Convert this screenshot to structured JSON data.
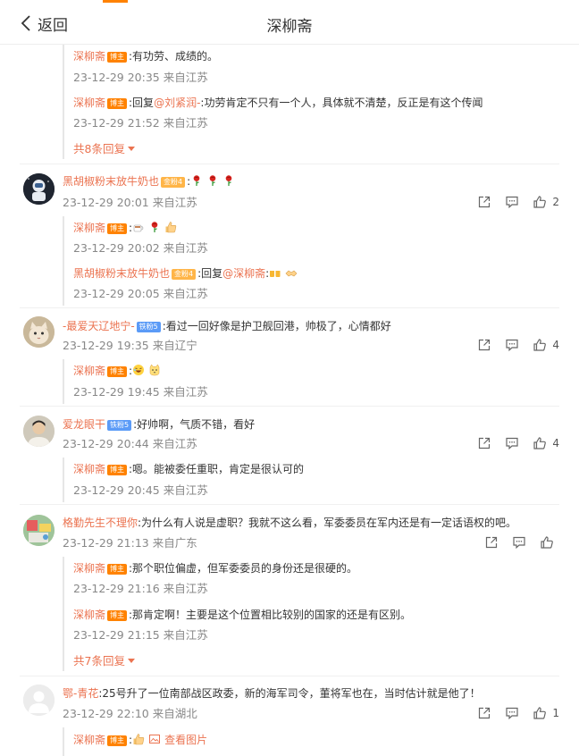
{
  "header": {
    "back_label": "返回",
    "title": "深柳斋"
  },
  "host_badge": "博主",
  "more_suffix": "回复",
  "comments": [
    {
      "replies": [
        {
          "name": "深柳斋",
          "badge": "博主",
          "text": ":有功劳、成绩的。",
          "time": "23-12-29 20:35 来自江苏"
        },
        {
          "name": "深柳斋",
          "badge": "博主",
          "pre": ":回复",
          "at": "@刘紧润-",
          "text": ":功劳肯定不只有一个人，具体就不清楚，反正是有这个传闻",
          "time": "23-12-29 21:52 来自江苏"
        }
      ],
      "more": "共8条回复"
    },
    {
      "name": "黑胡椒粉末放牛奶也",
      "badge": "金粉4",
      "text": ":",
      "emojis": [
        "rose",
        "rose",
        "rose"
      ],
      "time": "23-12-29 20:01 来自江苏",
      "likes": "2",
      "replies": [
        {
          "name": "深柳斋",
          "badge": "博主",
          "text": ":",
          "emojis": [
            "tea",
            "rose",
            "thumb"
          ],
          "time": "23-12-29 20:02 来自江苏"
        },
        {
          "name": "黑胡椒粉末放牛奶也",
          "badge": "金粉4",
          "pre": ":回复",
          "at": "@深柳斋",
          "text": ":",
          "emojis": [
            "beer",
            "hand"
          ],
          "time": "23-12-29 20:05 来自江苏"
        }
      ]
    },
    {
      "name": "-最爱天辽地宁-",
      "badge": "铁粉5",
      "text": ":看过一回好像是护卫舰回港，帅极了，心情都好",
      "time": "23-12-29 19:35 来自辽宁",
      "likes": "4",
      "replies": [
        {
          "name": "深柳斋",
          "badge": "博主",
          "text": ":",
          "emojis": [
            "laugh",
            "cat"
          ],
          "time": "23-12-29 19:45 来自江苏"
        }
      ]
    },
    {
      "name": "爱龙眼干",
      "badge": "铁粉5",
      "text": ":好帅啊，气质不错，看好",
      "time": "23-12-29 20:44 来自江苏",
      "likes": "4",
      "replies": [
        {
          "name": "深柳斋",
          "badge": "博主",
          "text": ":嗯。能被委任重职，肯定是很认可的",
          "time": "23-12-29 20:45 来自江苏"
        }
      ]
    },
    {
      "name": "格勤先生不理你",
      "text": ":为什么有人说是虚职？我就不这么看，军委委员在军内还是有一定话语权的吧。",
      "time": "23-12-29 21:13 来自广东",
      "likes": "",
      "replies": [
        {
          "name": "深柳斋",
          "badge": "博主",
          "text": ":那个职位偏虚，但军委委员的身份还是很硬的。",
          "time": "23-12-29 21:16 来自江苏"
        },
        {
          "name": "深柳斋",
          "badge": "博主",
          "text": ":那肯定啊！主要是这个位置相比较别的国家的还是有区别。",
          "time": "23-12-29 21:15 来自江苏"
        }
      ],
      "more": "共7条回复"
    },
    {
      "name": "鄂-青花",
      "text": ":25号升了一位南部战区政委，新的海军司令，董将军也在，当时估计就是他了！",
      "time": "23-12-29 22:10 来自湖北",
      "likes": "1",
      "replies": [
        {
          "name": "深柳斋",
          "badge": "博主",
          "text": ":",
          "emojis": [
            "thumb"
          ],
          "link": "查看图片"
        }
      ]
    }
  ]
}
